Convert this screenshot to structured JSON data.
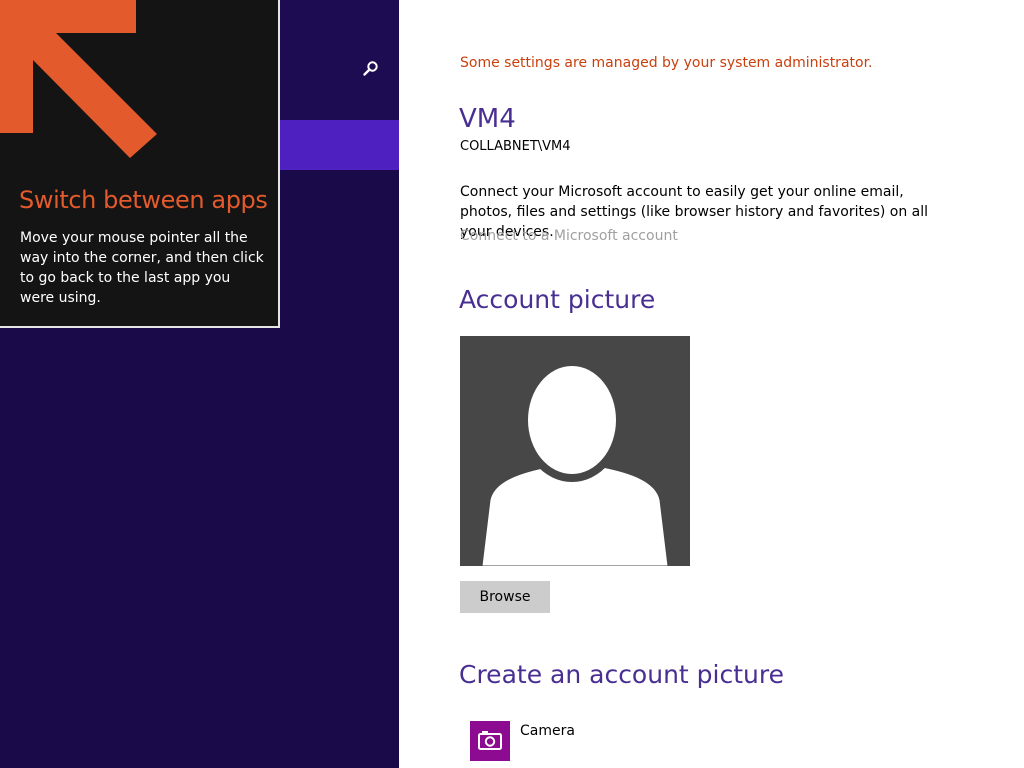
{
  "colors": {
    "left_background": "#1b0a4a",
    "nav_selected": "#4e20c0",
    "tip_background": "#141414",
    "tip_accent": "#e35a2c",
    "heading": "#4a2f92",
    "admin_warning": "#c9400e",
    "link_disabled": "#a0a0a0",
    "avatar_background": "#474747",
    "camera_tile": "#8c0b90"
  },
  "left_pane": {
    "search_icon": "search-icon"
  },
  "tip": {
    "title": "Switch between apps",
    "body": "Move your mouse pointer all the way into the corner, and then click to go back to the last app you were using.",
    "arrow_icon": "arrow-up-left-icon"
  },
  "account": {
    "admin_note": "Some settings are managed by your system administrator.",
    "name": "VM4",
    "domain_user": "COLLABNET\\VM4",
    "connect_description": "Connect your Microsoft account to easily get your online email, photos, files and settings (like browser history and favorites) on all your devices.",
    "connect_link": "Connect to a Microsoft account"
  },
  "account_picture": {
    "heading": "Account picture",
    "avatar_icon": "default-user-silhouette-icon",
    "browse_label": "Browse"
  },
  "create_picture": {
    "heading": "Create an account picture",
    "apps": [
      {
        "label": "Camera",
        "icon": "camera-icon"
      }
    ]
  }
}
